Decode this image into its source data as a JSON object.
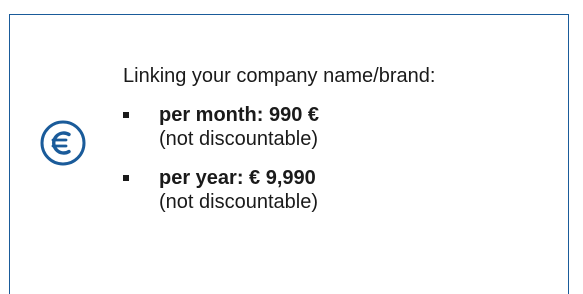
{
  "card": {
    "heading": "Linking your company name/brand:",
    "icon": "euro-icon",
    "accent_color": "#1a5b9a",
    "prices": [
      {
        "label": "per month: 990 €",
        "note": "(not discountable)"
      },
      {
        "label": "per year: € 9,990",
        "note": "(not discountable)"
      }
    ]
  }
}
